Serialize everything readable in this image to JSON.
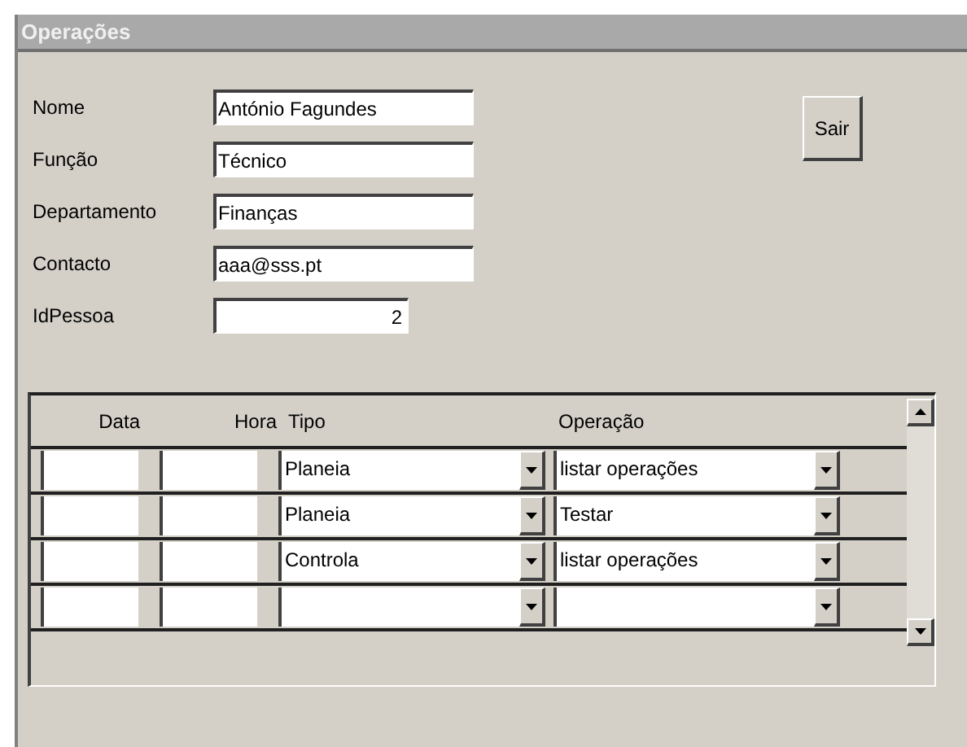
{
  "window": {
    "title": "Operações"
  },
  "fields": [
    {
      "label": "Nome",
      "value": "António Fagundes",
      "kind": "text"
    },
    {
      "label": "Função",
      "value": "Técnico",
      "kind": "text"
    },
    {
      "label": "Departamento",
      "value": "Finanças",
      "kind": "text"
    },
    {
      "label": "Contacto",
      "value": "aaa@sss.pt",
      "kind": "text"
    },
    {
      "label": "IdPessoa",
      "value": "2",
      "kind": "number"
    }
  ],
  "buttons": [
    "Sair"
  ],
  "table": {
    "columns": [
      "Data",
      "Hora",
      "Tipo",
      "Operação"
    ],
    "rows": [
      {
        "data": "",
        "hora": "",
        "tipo": "Planeia",
        "operacao": "listar operações"
      },
      {
        "data": "",
        "hora": "",
        "tipo": "Planeia",
        "operacao": "Testar"
      },
      {
        "data": "",
        "hora": "",
        "tipo": "Controla",
        "operacao": "listar operações"
      },
      {
        "data": "",
        "hora": "",
        "tipo": "",
        "operacao": ""
      }
    ]
  }
}
